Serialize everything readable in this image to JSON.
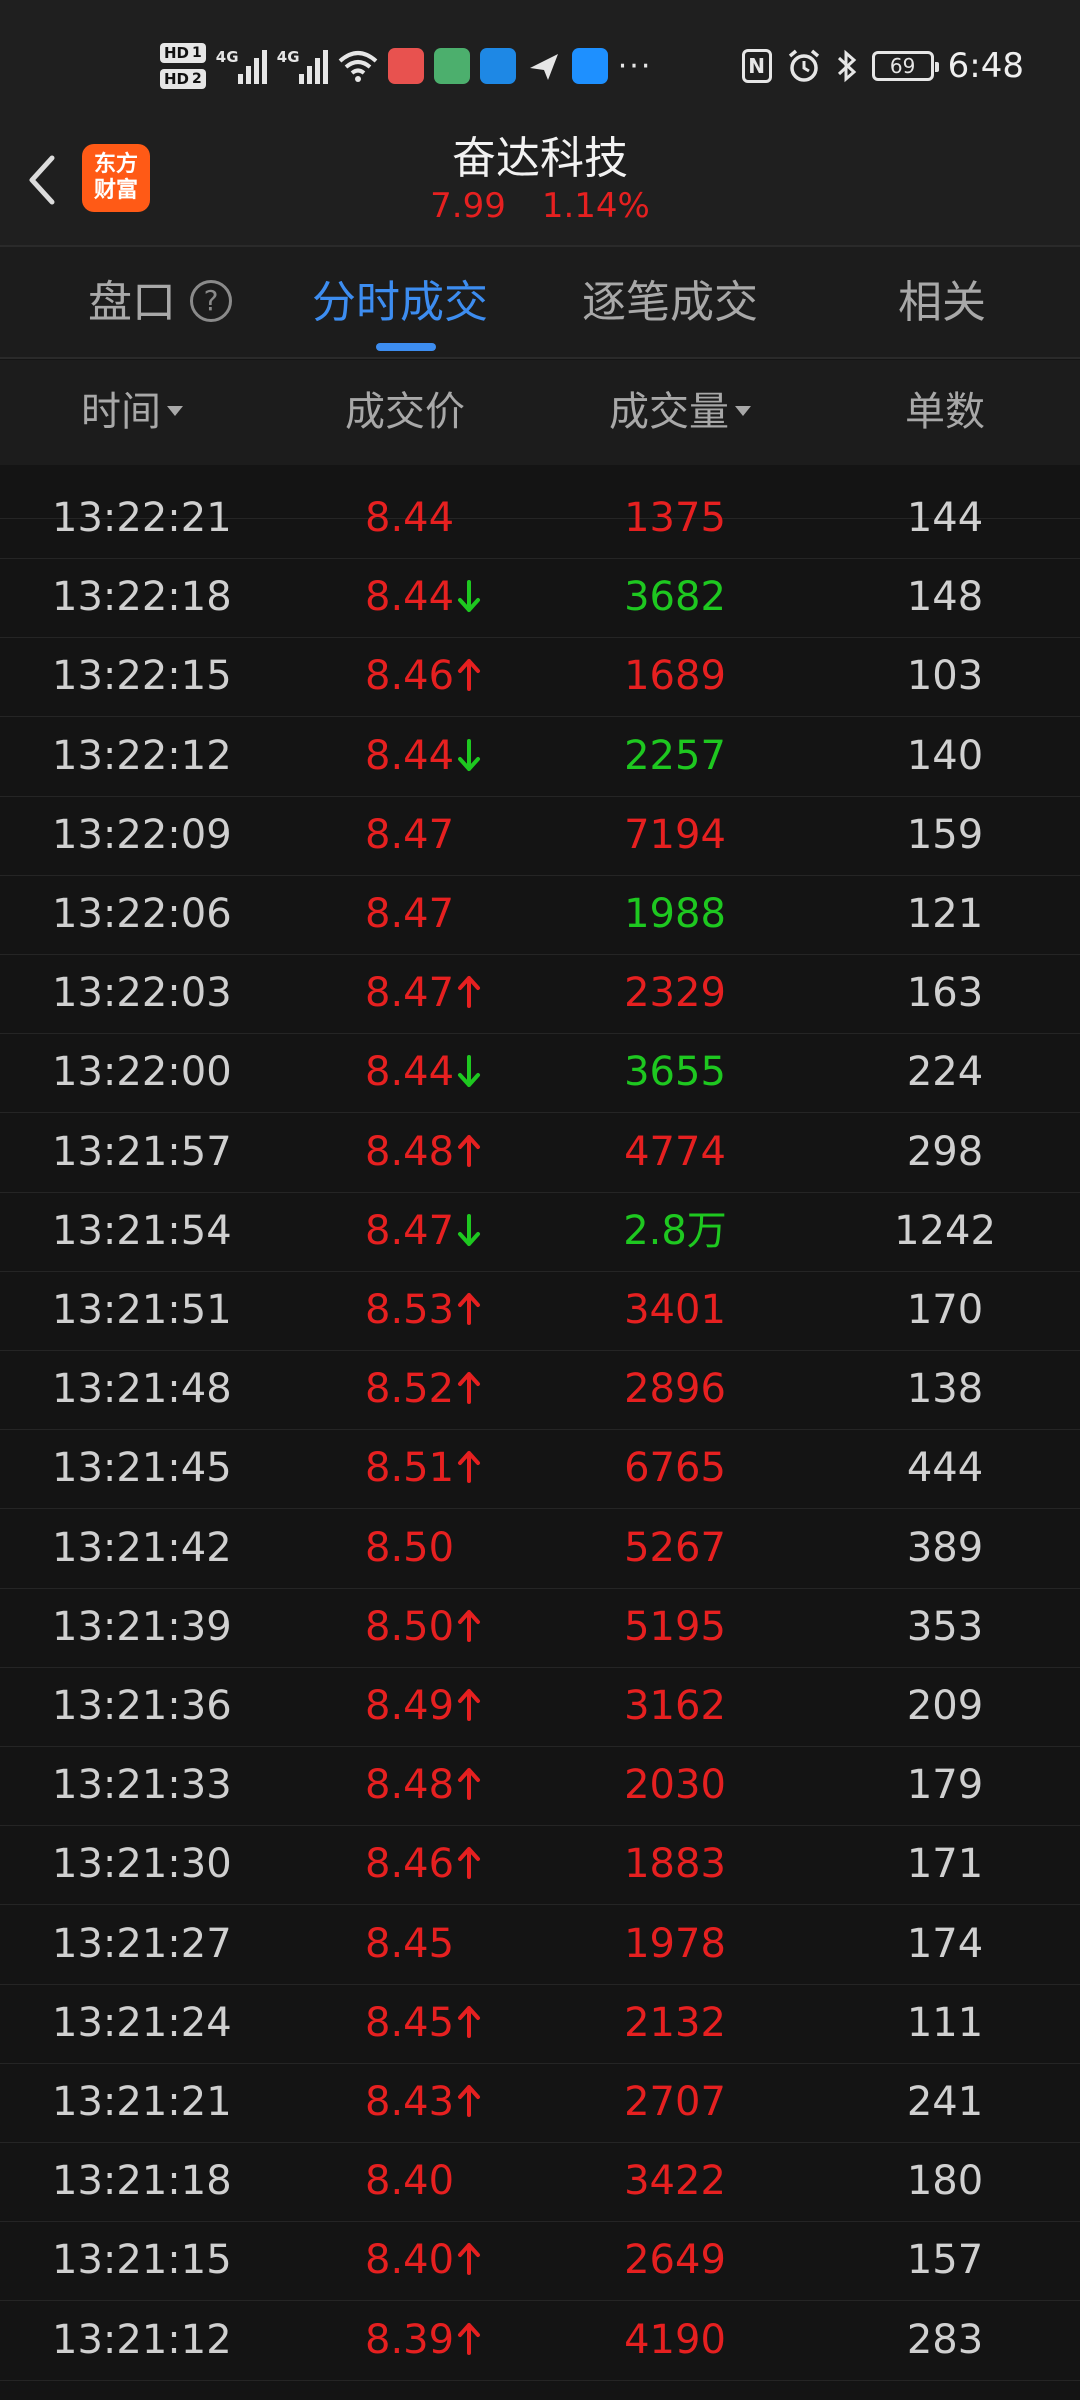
{
  "status_bar": {
    "hd1": "HD",
    "hd1_num": "1",
    "hd2": "HD",
    "hd2_num": "2",
    "sig1_label": "4G",
    "sig2_label": "4G",
    "more": "···",
    "nfc": "N",
    "battery": "69",
    "time": "6:48"
  },
  "header": {
    "logo_line1": "东方",
    "logo_line2": "财富",
    "title": "奋达科技",
    "price": "7.99",
    "change_pct": "1.14%"
  },
  "tabs": [
    {
      "label": "盘口",
      "active": false
    },
    {
      "label": "分时成交",
      "active": true
    },
    {
      "label": "逐笔成交",
      "active": false
    },
    {
      "label": "相关",
      "active": false
    }
  ],
  "help_icon_text": "?",
  "columns": {
    "time": "时间",
    "price": "成交价",
    "volume": "成交量",
    "count": "单数"
  },
  "colors": {
    "up": "#e62020",
    "down": "#1ec820",
    "accent": "#3d8df0"
  },
  "trades": [
    {
      "time": "13:22:21",
      "price": "8.44",
      "dir": "",
      "volume": "1375",
      "vol_color": "up",
      "count": "144"
    },
    {
      "time": "13:22:18",
      "price": "8.44",
      "dir": "down",
      "volume": "3682",
      "vol_color": "down",
      "count": "148"
    },
    {
      "time": "13:22:15",
      "price": "8.46",
      "dir": "up",
      "volume": "1689",
      "vol_color": "up",
      "count": "103"
    },
    {
      "time": "13:22:12",
      "price": "8.44",
      "dir": "down",
      "volume": "2257",
      "vol_color": "down",
      "count": "140"
    },
    {
      "time": "13:22:09",
      "price": "8.47",
      "dir": "",
      "volume": "7194",
      "vol_color": "up",
      "count": "159"
    },
    {
      "time": "13:22:06",
      "price": "8.47",
      "dir": "",
      "volume": "1988",
      "vol_color": "down",
      "count": "121"
    },
    {
      "time": "13:22:03",
      "price": "8.47",
      "dir": "up",
      "volume": "2329",
      "vol_color": "up",
      "count": "163"
    },
    {
      "time": "13:22:00",
      "price": "8.44",
      "dir": "down",
      "volume": "3655",
      "vol_color": "down",
      "count": "224"
    },
    {
      "time": "13:21:57",
      "price": "8.48",
      "dir": "up",
      "volume": "4774",
      "vol_color": "up",
      "count": "298"
    },
    {
      "time": "13:21:54",
      "price": "8.47",
      "dir": "down",
      "volume": "2.8万",
      "vol_color": "down",
      "count": "1242"
    },
    {
      "time": "13:21:51",
      "price": "8.53",
      "dir": "up",
      "volume": "3401",
      "vol_color": "up",
      "count": "170"
    },
    {
      "time": "13:21:48",
      "price": "8.52",
      "dir": "up",
      "volume": "2896",
      "vol_color": "up",
      "count": "138"
    },
    {
      "time": "13:21:45",
      "price": "8.51",
      "dir": "up",
      "volume": "6765",
      "vol_color": "up",
      "count": "444"
    },
    {
      "time": "13:21:42",
      "price": "8.50",
      "dir": "",
      "volume": "5267",
      "vol_color": "up",
      "count": "389"
    },
    {
      "time": "13:21:39",
      "price": "8.50",
      "dir": "up",
      "volume": "5195",
      "vol_color": "up",
      "count": "353"
    },
    {
      "time": "13:21:36",
      "price": "8.49",
      "dir": "up",
      "volume": "3162",
      "vol_color": "up",
      "count": "209"
    },
    {
      "time": "13:21:33",
      "price": "8.48",
      "dir": "up",
      "volume": "2030",
      "vol_color": "up",
      "count": "179"
    },
    {
      "time": "13:21:30",
      "price": "8.46",
      "dir": "up",
      "volume": "1883",
      "vol_color": "up",
      "count": "171"
    },
    {
      "time": "13:21:27",
      "price": "8.45",
      "dir": "",
      "volume": "1978",
      "vol_color": "up",
      "count": "174"
    },
    {
      "time": "13:21:24",
      "price": "8.45",
      "dir": "up",
      "volume": "2132",
      "vol_color": "up",
      "count": "111"
    },
    {
      "time": "13:21:21",
      "price": "8.43",
      "dir": "up",
      "volume": "2707",
      "vol_color": "up",
      "count": "241"
    },
    {
      "time": "13:21:18",
      "price": "8.40",
      "dir": "",
      "volume": "3422",
      "vol_color": "up",
      "count": "180"
    },
    {
      "time": "13:21:15",
      "price": "8.40",
      "dir": "up",
      "volume": "2649",
      "vol_color": "up",
      "count": "157"
    },
    {
      "time": "13:21:12",
      "price": "8.39",
      "dir": "up",
      "volume": "4190",
      "vol_color": "up",
      "count": "283"
    }
  ]
}
